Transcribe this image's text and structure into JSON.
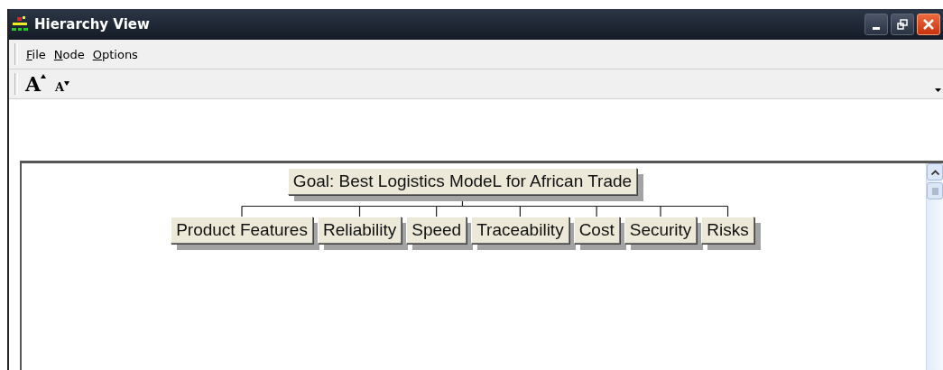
{
  "window": {
    "title": "Hierarchy View"
  },
  "menu": [
    {
      "label": "File"
    },
    {
      "label": "Node"
    },
    {
      "label": "Options"
    }
  ],
  "toolbar": [
    {
      "kind": "grow",
      "glyph": "A"
    },
    {
      "kind": "shrink",
      "glyph": "A"
    }
  ],
  "hierarchy": {
    "goal": "Goal: Best Logistics ModeL for African Trade",
    "criteria": [
      {
        "label": "Product Features"
      },
      {
        "label": "Reliability"
      },
      {
        "label": "Speed"
      },
      {
        "label": "Traceability"
      },
      {
        "label": "Cost"
      },
      {
        "label": "Security"
      },
      {
        "label": "Risks"
      }
    ]
  }
}
